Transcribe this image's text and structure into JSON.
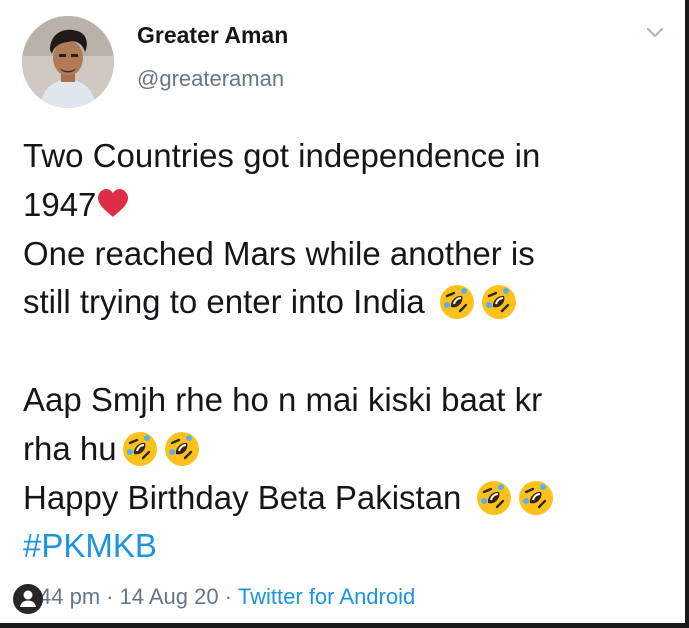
{
  "user": {
    "display_name": "Greater Aman",
    "handle": "@greateraman"
  },
  "tweet": {
    "line1": "Two Countries got independence in",
    "line2": "1947",
    "line3": "One reached Mars while another is",
    "line4": "still trying to enter into India",
    "line5": "Aap Smjh rhe ho n mai kiski baat kr",
    "line6": "rha hu",
    "line7": "Happy Birthday Beta Pakistan",
    "hashtag": "#PKMKB"
  },
  "meta": {
    "time": "44 pm",
    "sep1": "·",
    "date": "14 Aug 20",
    "sep2": "·",
    "source": "Twitter for Android"
  },
  "icons": {
    "heart": "red-heart-icon",
    "laugh": "rolling-on-floor-laughing-icon",
    "chevron": "chevron-down-icon",
    "overlay": "user-circle-icon"
  },
  "colors": {
    "text": "#14171a",
    "secondary": "#657786",
    "link": "#1b95e0",
    "heart": "#dd2e44",
    "emoji_face": "#fcc21b"
  }
}
